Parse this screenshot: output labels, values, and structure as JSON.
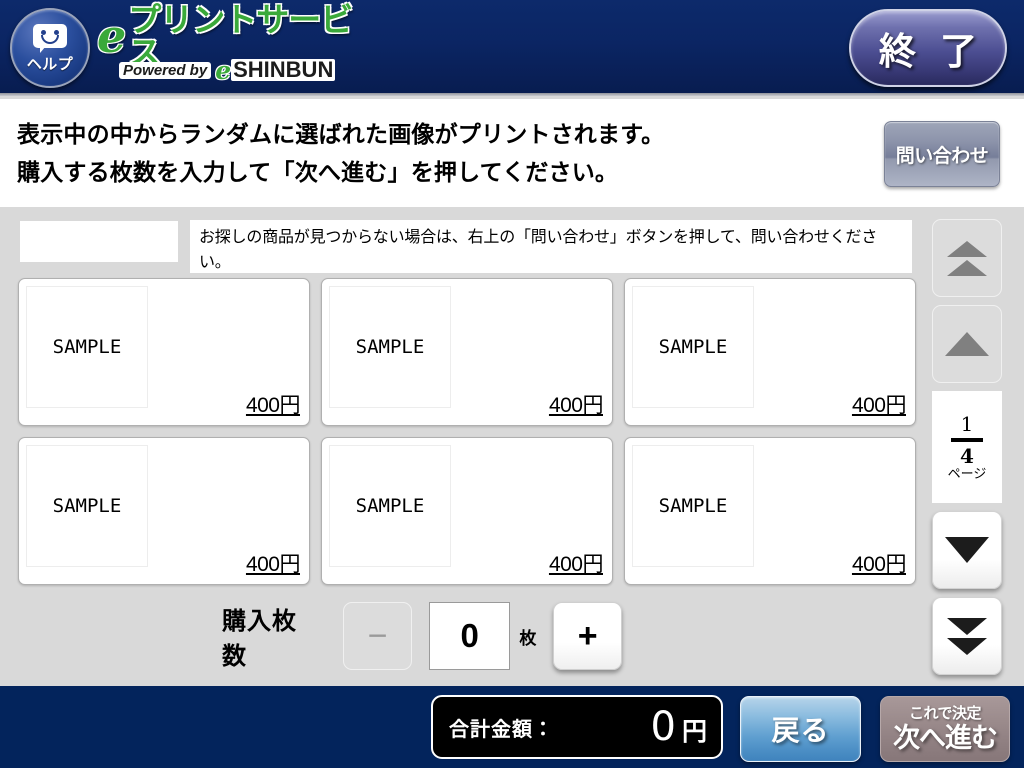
{
  "header": {
    "help_button": {
      "label": "ヘルプ",
      "icon": "speech-bubble-smiley-icon"
    },
    "logo": {
      "e": "e",
      "main": "プリントサービス",
      "powered_by": "Powered by",
      "brand_e": "e",
      "brand": "SHINBUN"
    },
    "exit_button": {
      "label": "終 了"
    }
  },
  "instruction": {
    "line1": "表示中の中からランダムに選ばれた画像がプリントされます。",
    "line2": "購入する枚数を入力して「次へ進む」を押してください。",
    "inquiry_button": "問い合わせ"
  },
  "notice": {
    "text": "お探しの商品が見つからない場合は、右上の「問い合わせ」ボタンを押して、問い合わせください。"
  },
  "items": [
    {
      "thumb_label": "SAMPLE",
      "price": "400円"
    },
    {
      "thumb_label": "SAMPLE",
      "price": "400円"
    },
    {
      "thumb_label": "SAMPLE",
      "price": "400円"
    },
    {
      "thumb_label": "SAMPLE",
      "price": "400円"
    },
    {
      "thumb_label": "SAMPLE",
      "price": "400円"
    },
    {
      "thumb_label": "SAMPLE",
      "price": "400円"
    }
  ],
  "quantity": {
    "label": "購入枚数",
    "minus_label": "−",
    "plus_label": "+",
    "value": "0",
    "unit": "枚"
  },
  "pager": {
    "first_page_icon": "double-chevron-up-icon",
    "prev_page_icon": "chevron-up-icon",
    "next_page_icon": "chevron-down-icon",
    "last_page_icon": "double-chevron-down-icon",
    "current_page": "1",
    "total_pages": "4",
    "page_unit": "ページ"
  },
  "footer": {
    "total_label": "合計金額：",
    "total_amount": "0",
    "total_currency": "円",
    "back_button": "戻る",
    "next_button_top": "これで決定",
    "next_button_main": "次へ進む"
  },
  "colors": {
    "header_navy": "#0b2563",
    "footer_navy": "#03245c",
    "content_gray": "#d9d9d9",
    "logo_green": "#3aa93a",
    "exit_purple": "#4c4e92",
    "back_blue": "#5f9fd0",
    "next_disabled": "#9c8c8d"
  }
}
